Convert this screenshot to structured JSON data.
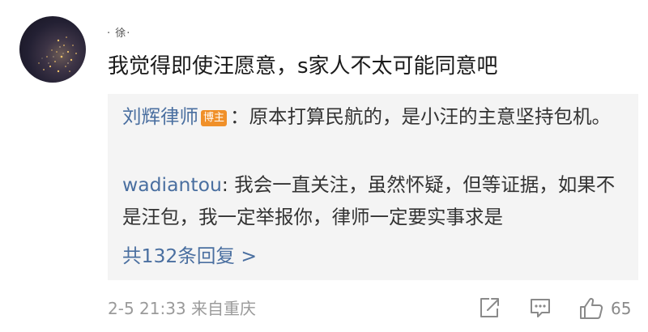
{
  "comment": {
    "username": "· 徐·",
    "text": "我觉得即使汪愿意，s家人不太可能同意吧",
    "time": "2-5 21:33",
    "location": "来自重庆",
    "likes": "65"
  },
  "replies": [
    {
      "name": "刘辉律师",
      "badge": "博主",
      "separator": "：",
      "text": "原本打算民航的，是小汪的主意坚持包机。"
    },
    {
      "name": "wadiantou",
      "separator": ": ",
      "text": "我会一直关注，虽然怀疑，但等证据，如果不是汪包，我一定举报你，律师一定要实事求是"
    }
  ],
  "more_replies": "共132条回复 >",
  "icons": {
    "share": "share-icon",
    "comment": "comment-icon",
    "like": "thumbs-up-icon"
  },
  "colors": {
    "link": "#4a6fa0",
    "badge": "#f09029",
    "reply_background": "#f4f4f4",
    "meta": "#9a9a9a"
  }
}
